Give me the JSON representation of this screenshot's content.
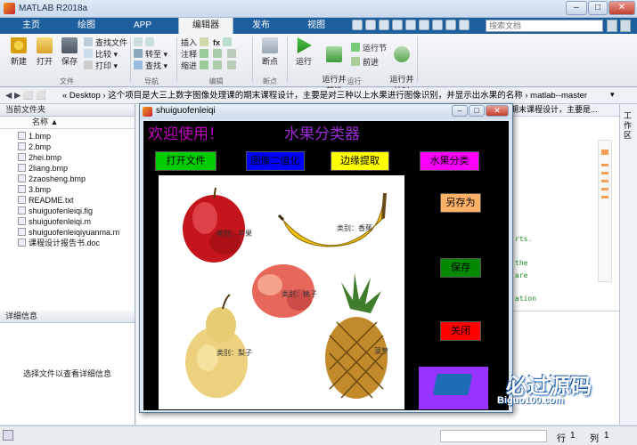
{
  "window": {
    "title": "MATLAB R2018a",
    "min": "–",
    "max": "□",
    "close": "✕"
  },
  "tabs": [
    "主页",
    "绘图",
    "APP",
    "编辑器",
    "发布",
    "视图"
  ],
  "search_docs_placeholder": "搜索文档",
  "ribbon": {
    "file": {
      "new": "新建",
      "open": "打开",
      "save": "保存",
      "find_files": "查找文件",
      "compare": "比较",
      "print": "打印",
      "label": "文件"
    },
    "navigate": {
      "goto": "转至",
      "find": "查找",
      "label": "导航"
    },
    "edit": {
      "insert": "插入",
      "comment": "注释",
      "indent": "缩进",
      "fx": "fx",
      "label": "编辑"
    },
    "breakpoints": {
      "bp": "断点",
      "label": "断点"
    },
    "run": {
      "run": "运行",
      "run_advance": "运行并\n前进",
      "run_section": "运行节",
      "advance": "前进",
      "run_time": "运行并\n计时",
      "label": "运行"
    }
  },
  "address": {
    "path": "« Desktop › 这个项目是大三上数字图像处理课的期末课程设计，主要是对三种以上水果进行图像识别，并显示出水果的名称 › matlab--master"
  },
  "left_panel": {
    "header": "当前文件夹",
    "column": "名称 ▲",
    "files": [
      "1.bmp",
      "2.bmp",
      "2hei.bmp",
      "2liang.bmp",
      "2zaosheng.bmp",
      "3.bmp",
      "README.txt",
      "shuiguofenleiqi.fig",
      "shuiguofenleiqi.m",
      "shuiguofenleiqiyuanma.m",
      "课程设计报告书.doc"
    ],
    "details_header": "详细信息",
    "details_text": "选择文件以查看详细信息"
  },
  "editor_snippet": {
    "header_text": "期末课程设计，主要是...",
    "lines": [
      "rts.",
      "the",
      "are",
      "ation"
    ]
  },
  "right_strip": {
    "label": "工作区"
  },
  "figure": {
    "title": "shuiguofenleiqi",
    "welcome": "欢迎使用！",
    "app_name": "水果分类器",
    "buttons": {
      "open": "打开文件",
      "gray": "图像二值化",
      "edge": "边缘提取",
      "classify": "水果分类",
      "save_as": "另存为",
      "save": "保存",
      "close": "关闭"
    },
    "labels": {
      "apple": "类别：苹果",
      "banana": "类别：香蕉",
      "peach": "类别：桃子",
      "pear": "类别：梨子",
      "pineapple": "菠萝"
    }
  },
  "status": {
    "line_label": "行",
    "line": "1",
    "col_label": "列",
    "col": "1"
  },
  "watermark": {
    "big": "必过源码",
    "small": "Biguo100.com"
  },
  "colors": {
    "accent": "#1d5f9e",
    "magenta": "#ff00ff",
    "green": "#00cc00",
    "blue": "#0000ff",
    "yellow": "#ffff00",
    "orange": "#ffb266",
    "red": "#ff0000",
    "purple": "#9933ff"
  }
}
